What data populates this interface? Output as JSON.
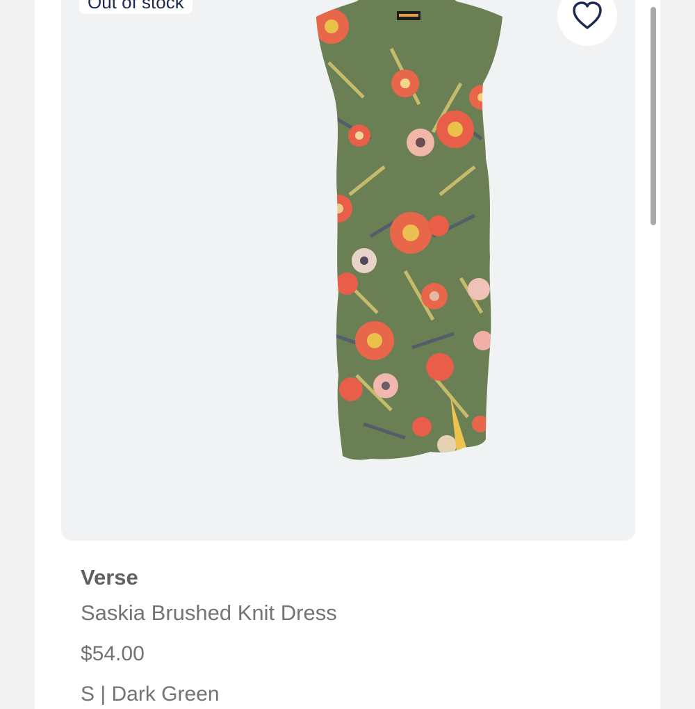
{
  "product": {
    "stock_badge": "Out of stock",
    "brand": "Verse",
    "name": "Saskia Brushed Knit Dress",
    "price": "$54.00",
    "variant": "S | Dark Green",
    "image_label": "Saskia Brushed Knit Dress floral print image"
  },
  "icons": {
    "favorite": "heart-icon"
  },
  "colors": {
    "accent": "#1d2b52",
    "dress_base": "#6b7f55",
    "flower_coral": "#e8664a",
    "flower_yellow": "#e9c14a",
    "image_background": "#f1f2f4"
  }
}
